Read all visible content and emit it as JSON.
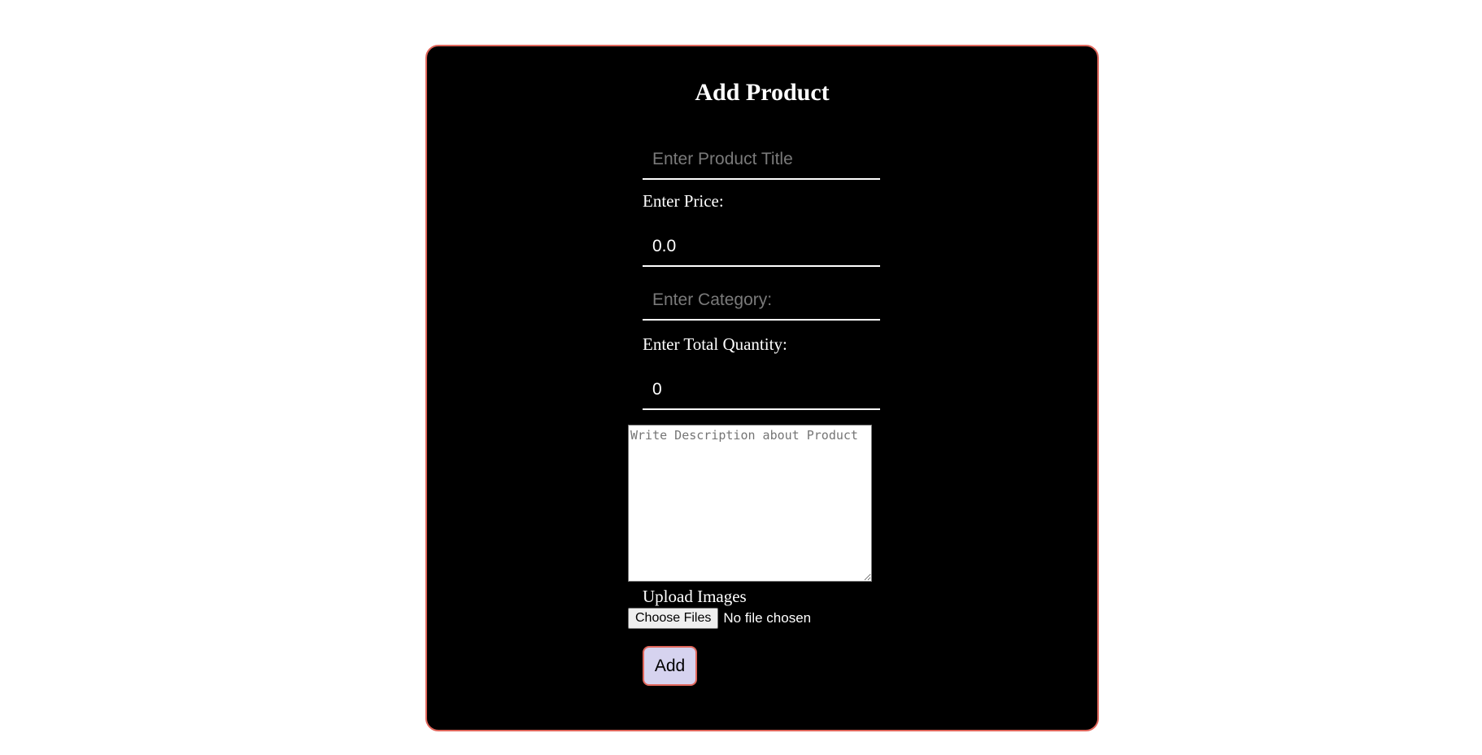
{
  "form": {
    "title": "Add Product",
    "product_title": {
      "value": "",
      "placeholder": "Enter Product Title"
    },
    "price": {
      "label": "Enter Price:",
      "value": "0.0"
    },
    "category": {
      "value": "",
      "placeholder": "Enter Category:"
    },
    "quantity": {
      "label": "Enter Total Quantity:",
      "value": "0"
    },
    "description": {
      "value": "",
      "placeholder": "Write Description about Product"
    },
    "upload": {
      "label": "Upload Images",
      "button_label": "Choose Files",
      "status": "No file chosen"
    },
    "submit_label": "Add"
  },
  "colors": {
    "card_background": "#000000",
    "card_border": "#e0675c",
    "button_background": "#d6d3ef",
    "text": "#ffffff"
  }
}
